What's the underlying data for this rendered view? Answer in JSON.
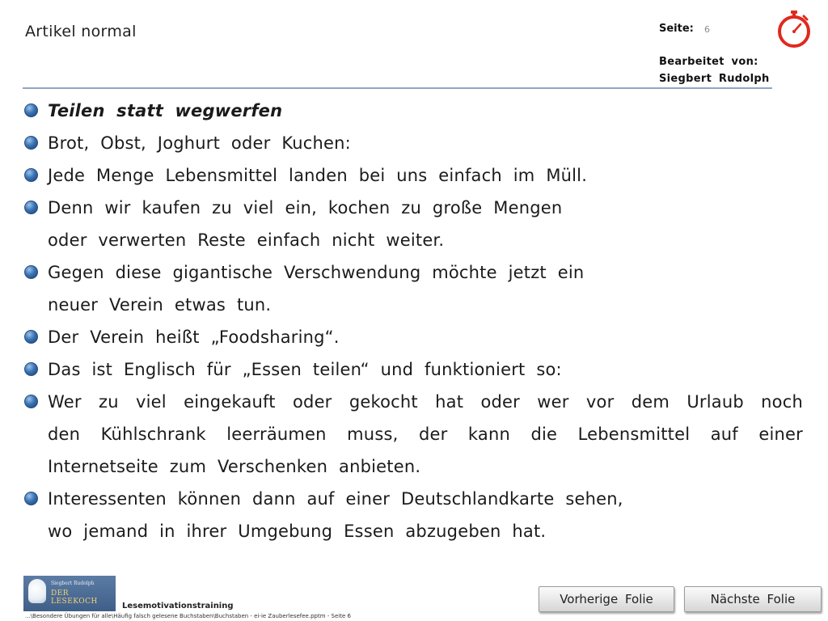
{
  "header": {
    "title": "Artikel normal",
    "page_label": "Seite:",
    "page_number": "6",
    "edited_by_label": "Bearbeitet von:",
    "editor_name": "Siegbert Rudolph",
    "timer_icon": "stopwatch-icon",
    "timer_color": "#e0291e"
  },
  "accent": {
    "rule_color": "#8fa6c4",
    "bullet_color": "#3a74b4"
  },
  "bullets": [
    {
      "lines": [
        "Teilen statt wegwerfen"
      ],
      "style": "bold-italic"
    },
    {
      "lines": [
        "Brot, Obst, Joghurt oder Kuchen:"
      ]
    },
    {
      "lines": [
        "Jede Menge Lebensmittel landen bei uns einfach im Müll."
      ]
    },
    {
      "lines": [
        "Denn wir kaufen zu viel ein, kochen zu große Mengen",
        "oder verwerten Reste einfach nicht weiter."
      ]
    },
    {
      "lines": [
        "Gegen diese gigantische Verschwendung möchte jetzt ein",
        "neuer Verein etwas tun."
      ]
    },
    {
      "lines": [
        "Der Verein heißt „Foodsharing“."
      ]
    },
    {
      "lines": [
        "Das ist Englisch für „Essen teilen“ und funktioniert so:"
      ]
    },
    {
      "lines": [
        "Wer zu  viel eingekauft oder gekocht hat oder wer vor dem Urlaub noch",
        "den Kühlschrank leerräumen muss, der kann die Lebensmittel auf einer",
        "Internetseite zum Verschenken anbieten."
      ],
      "justify": true
    },
    {
      "lines": [
        "Interessenten können dann auf einer Deutschlandkarte sehen,",
        "wo jemand in ihrer Umgebung Essen abzugeben hat."
      ]
    }
  ],
  "footer": {
    "logo_line1": "Siegbert Rudolph",
    "logo_line2": "DER LESEKOCH",
    "title": "Lesemotivationstraining",
    "path": "...\\Besondere Übungen für alle\\Häufig falsch gelesene Buchstaben\\Buchstaben - ei-ie Zauberlesefee.pptm - Seite 6",
    "prev_label": "Vorherige Folie",
    "next_label": "Nächste Folie"
  }
}
